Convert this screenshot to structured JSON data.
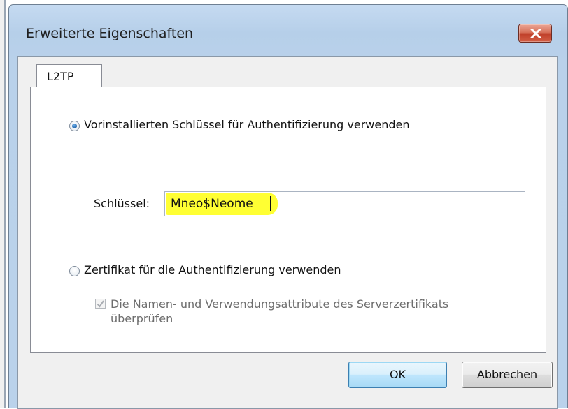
{
  "window": {
    "title": "Erweiterte Eigenschaften"
  },
  "tabs": [
    {
      "label": "L2TP"
    }
  ],
  "auth": {
    "psk_option_label": "Vorinstallierten Schlüssel für Authentifizierung verwenden",
    "key_label": "Schlüssel:",
    "key_value": "Mneo$Neome",
    "cert_option_label": "Zertifikat für die Authentifizierung verwenden",
    "verify_line1": "Die Namen- und Verwendungsattribute des Serverzertifikats",
    "verify_line2": "überprüfen",
    "psk_selected": true,
    "verify_checked": true,
    "verify_enabled": false
  },
  "buttons": {
    "ok": "OK",
    "cancel": "Abbrechen"
  },
  "colors": {
    "highlight": "#ffff33",
    "title_bar": "#bad2eb",
    "close_button": "#c7503a"
  }
}
